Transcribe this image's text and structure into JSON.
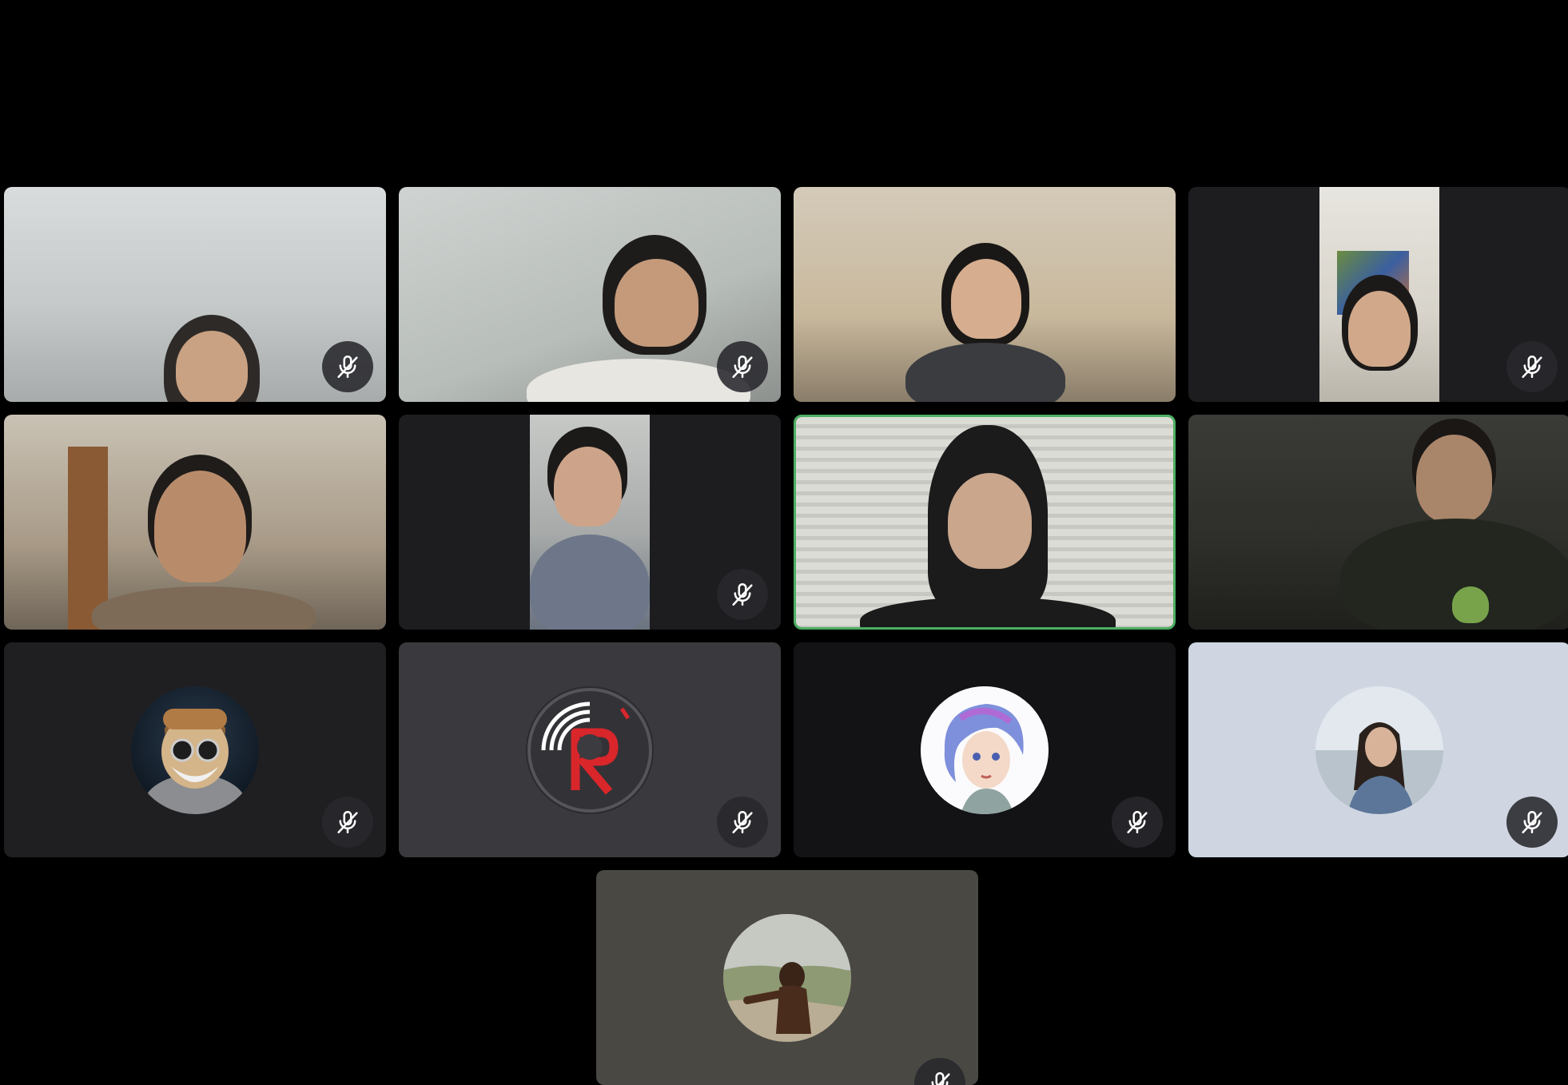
{
  "meeting": {
    "accent_speaking": "#4caf62",
    "icons": {
      "mute": "mic-off-icon"
    }
  },
  "participants": [
    {
      "id": 1,
      "mode": "video",
      "muted": true
    },
    {
      "id": 2,
      "mode": "video",
      "muted": true
    },
    {
      "id": 3,
      "mode": "video",
      "muted": false
    },
    {
      "id": 4,
      "mode": "video",
      "muted": true
    },
    {
      "id": 5,
      "mode": "video",
      "muted": false
    },
    {
      "id": 6,
      "mode": "video",
      "muted": true
    },
    {
      "id": 7,
      "mode": "video",
      "muted": false,
      "speaking": true
    },
    {
      "id": 8,
      "mode": "video",
      "muted": false
    },
    {
      "id": 9,
      "mode": "avatar",
      "muted": true,
      "avatar_icon": "bearded-tiger-avatar-icon",
      "tile_color": "#1f1f22"
    },
    {
      "id": 10,
      "mode": "avatar",
      "muted": true,
      "avatar_icon": "red-r-logo-avatar-icon",
      "tile_color": "#3a393d"
    },
    {
      "id": 11,
      "mode": "avatar",
      "muted": true,
      "avatar_icon": "anime-girl-avatar-icon",
      "tile_color": "#131316"
    },
    {
      "id": 12,
      "mode": "avatar",
      "muted": true,
      "avatar_icon": "beach-photo-avatar-icon",
      "tile_color": "#cfd6e2"
    },
    {
      "id": 13,
      "mode": "avatar",
      "muted": true,
      "avatar_icon": "orangutan-avatar-icon",
      "tile_color": "#4a4843"
    }
  ]
}
